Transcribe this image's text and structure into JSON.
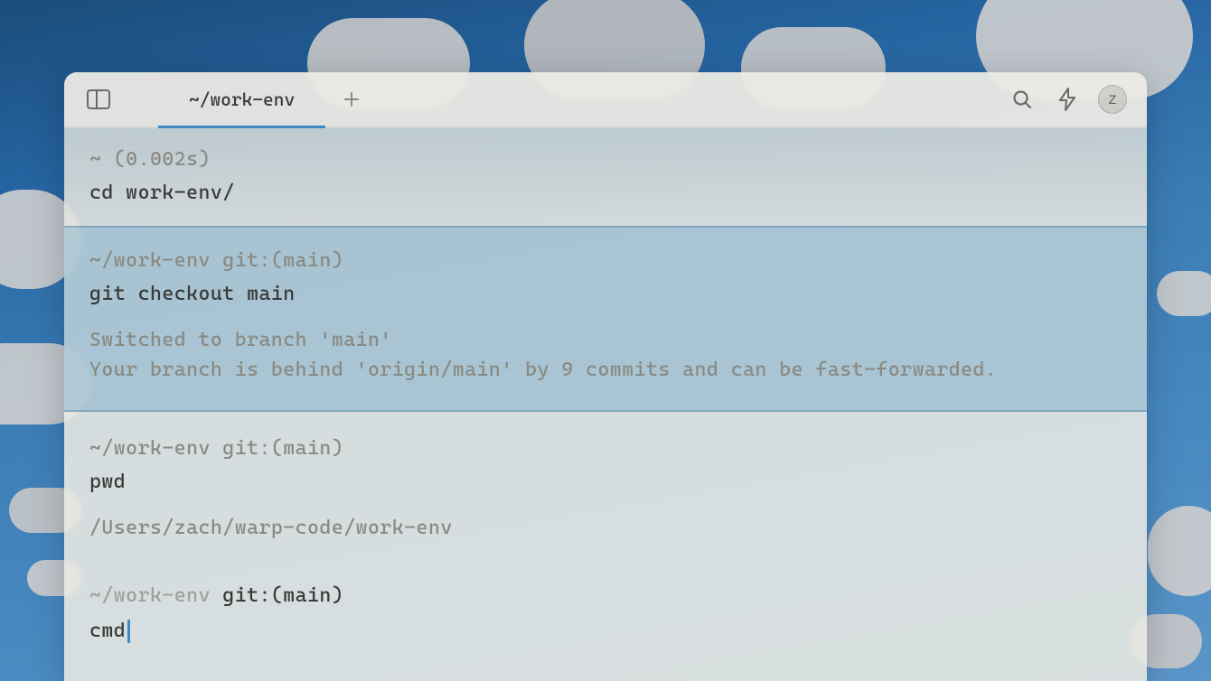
{
  "tabs": {
    "active": "~/work-env"
  },
  "avatar": {
    "initial": "Z"
  },
  "blocks": [
    {
      "prompt": "~ (0.002s)",
      "command": "cd work-env/",
      "output": ""
    },
    {
      "prompt": "~/work-env git:(main)",
      "command": "git checkout main",
      "output": "Switched to branch 'main'\nYour branch is behind 'origin/main' by 9 commits and can be fast-forwarded."
    },
    {
      "prompt": "~/work-env git:(main)",
      "command": "pwd",
      "output": "/Users/zach/warp-code/work-env"
    }
  ],
  "active_prompt": {
    "path": "~/work-env ",
    "git": "git:(main)"
  },
  "input": "cmd"
}
